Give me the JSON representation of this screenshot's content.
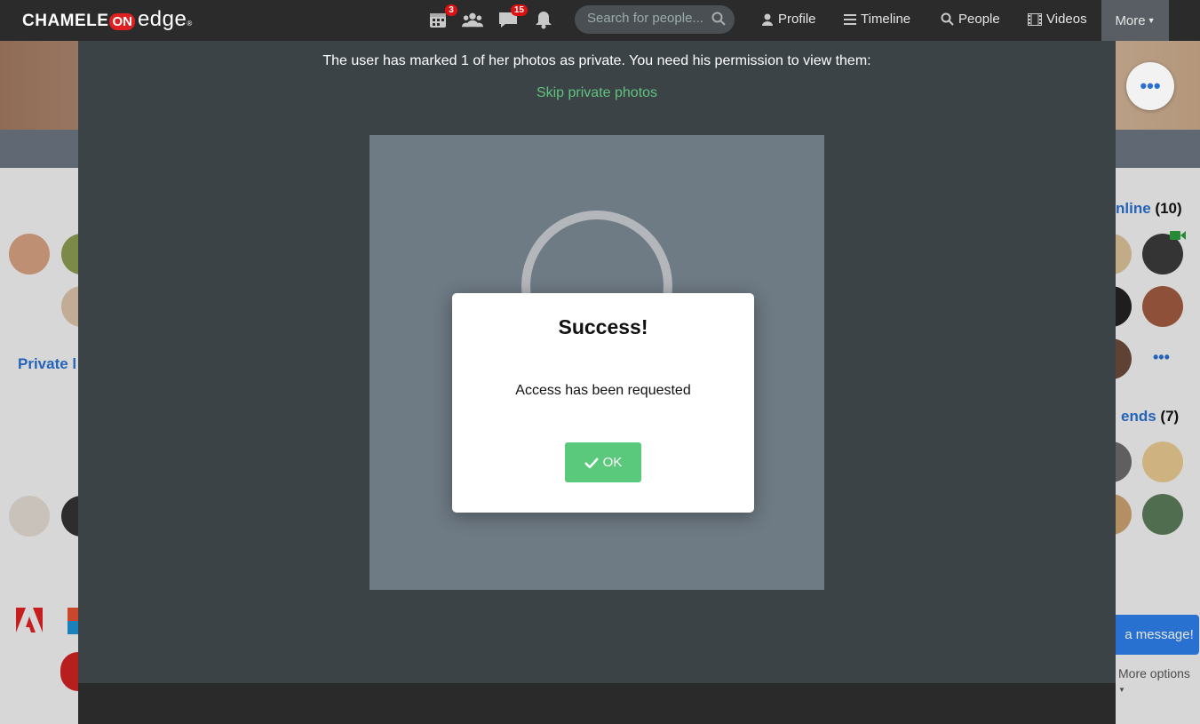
{
  "brand": {
    "logo_pre": "CHAMELE",
    "logo_on": "ON",
    "logo_post": "edge",
    "logo_reg": "®"
  },
  "nav": {
    "calendar_badge": "3",
    "messages_badge": "15",
    "search_placeholder": "Search for people...",
    "profile": "Profile",
    "timeline": "Timeline",
    "people": "People",
    "videos": "Videos",
    "more": "More"
  },
  "background": {
    "online_label": "nline",
    "online_count": "(10)",
    "friends_label": "ends",
    "friends_count": "(7)",
    "private_label": "Private l",
    "send_message": "a message!",
    "more_options": "More options"
  },
  "modal": {
    "notice": "The user has marked 1 of her photos as private. You need his permission to view them:",
    "skip": "Skip private photos"
  },
  "dialog": {
    "title": "Success!",
    "message": "Access has been requested",
    "ok": "OK"
  }
}
